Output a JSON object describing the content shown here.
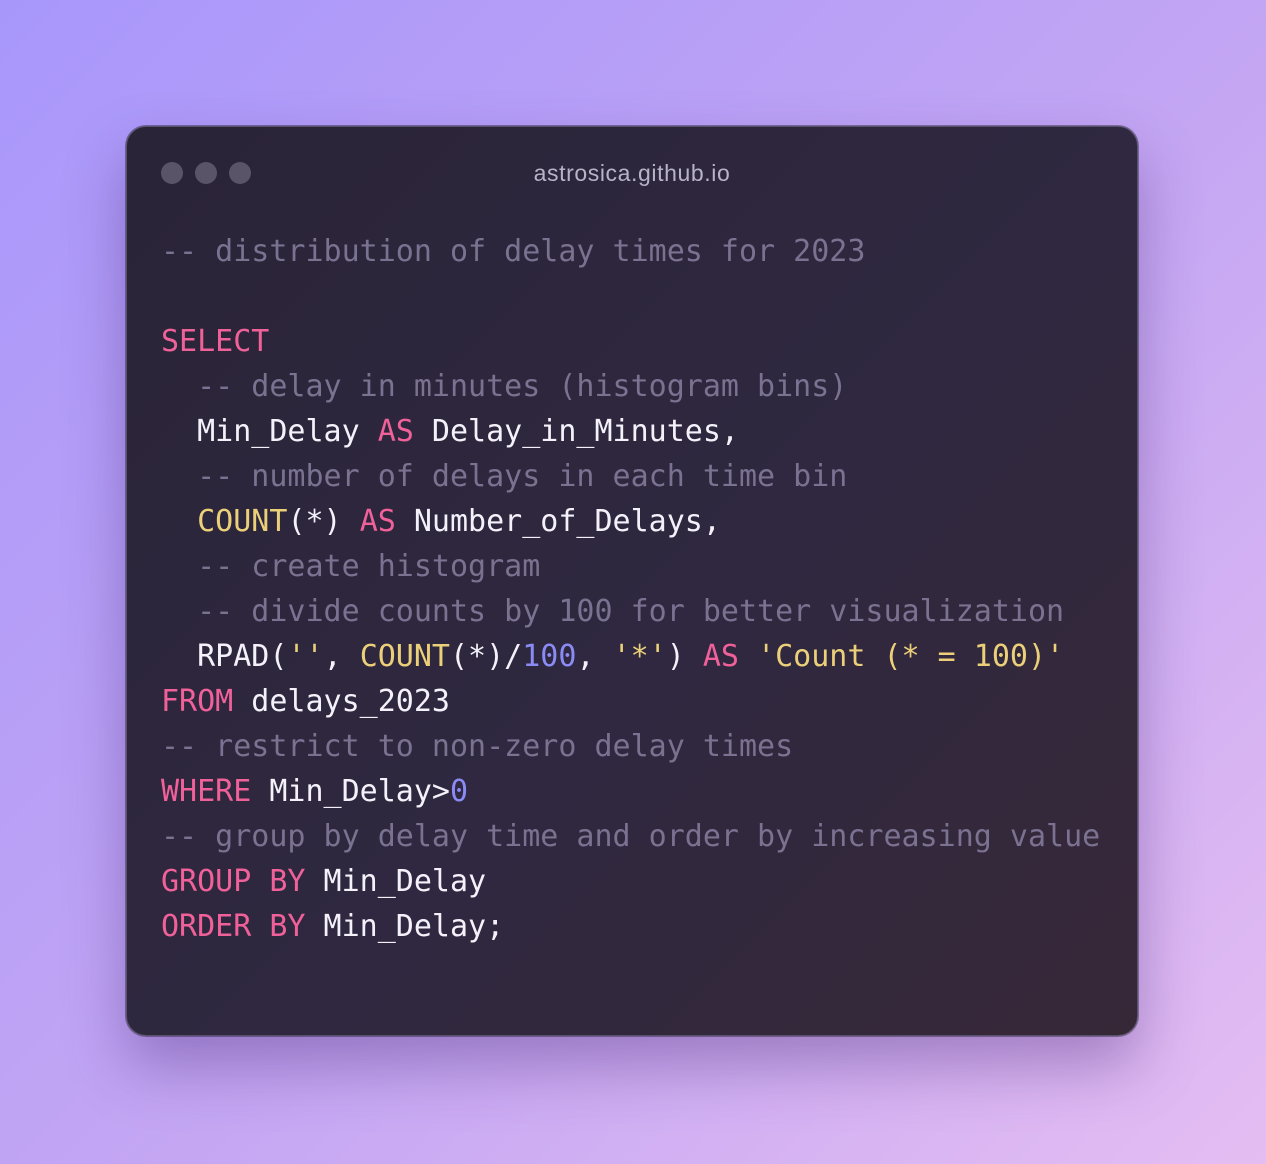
{
  "window": {
    "title": "astrosica.github.io"
  },
  "colors": {
    "background_start": "#a897fb",
    "background_end": "#e4bdf2",
    "window_bg": "#2a2438",
    "comment": "#7a7290",
    "keyword": "#f0619a",
    "function": "#ecd079",
    "string": "#ecd079",
    "number": "#8b8bf6",
    "identifier": "#f4f1fa"
  },
  "code": {
    "l1": {
      "comment": "-- distribution of delay times for 2023"
    },
    "l3": {
      "kw": "SELECT"
    },
    "l4": {
      "comment": "  -- delay in minutes (histogram bins)"
    },
    "l5": {
      "a": "  Min_Delay ",
      "kw": "AS",
      "b": " Delay_in_Minutes,"
    },
    "l6": {
      "comment": "  -- number of delays in each time bin"
    },
    "l7": {
      "pre": "  ",
      "fn": "COUNT",
      "a": "(*) ",
      "kw": "AS",
      "b": " Number_of_Delays,"
    },
    "l8": {
      "comment": "  -- create histogram"
    },
    "l9": {
      "comment": "  -- divide counts by 100 for better visualization"
    },
    "l10": {
      "a": "  RPAD(",
      "s1": "''",
      "b": ", ",
      "fn": "COUNT",
      "c": "(*)/",
      "num": "100",
      "d": ", ",
      "s2": "'*'",
      "e": ") ",
      "kw": "AS",
      "f": " ",
      "s3": "'Count (* = 100)'"
    },
    "l11": {
      "kw": "FROM",
      "a": " delays_2023"
    },
    "l12": {
      "comment": "-- restrict to non-zero delay times"
    },
    "l13": {
      "kw": "WHERE",
      "a": " Min_Delay>",
      "num": "0"
    },
    "l14": {
      "comment": "-- group by delay time and order by increasing value"
    },
    "l15": {
      "kw1": "GROUP",
      "sp": " ",
      "kw2": "BY",
      "a": " Min_Delay"
    },
    "l16": {
      "kw1": "ORDER",
      "sp": " ",
      "kw2": "BY",
      "a": " Min_Delay;"
    }
  }
}
